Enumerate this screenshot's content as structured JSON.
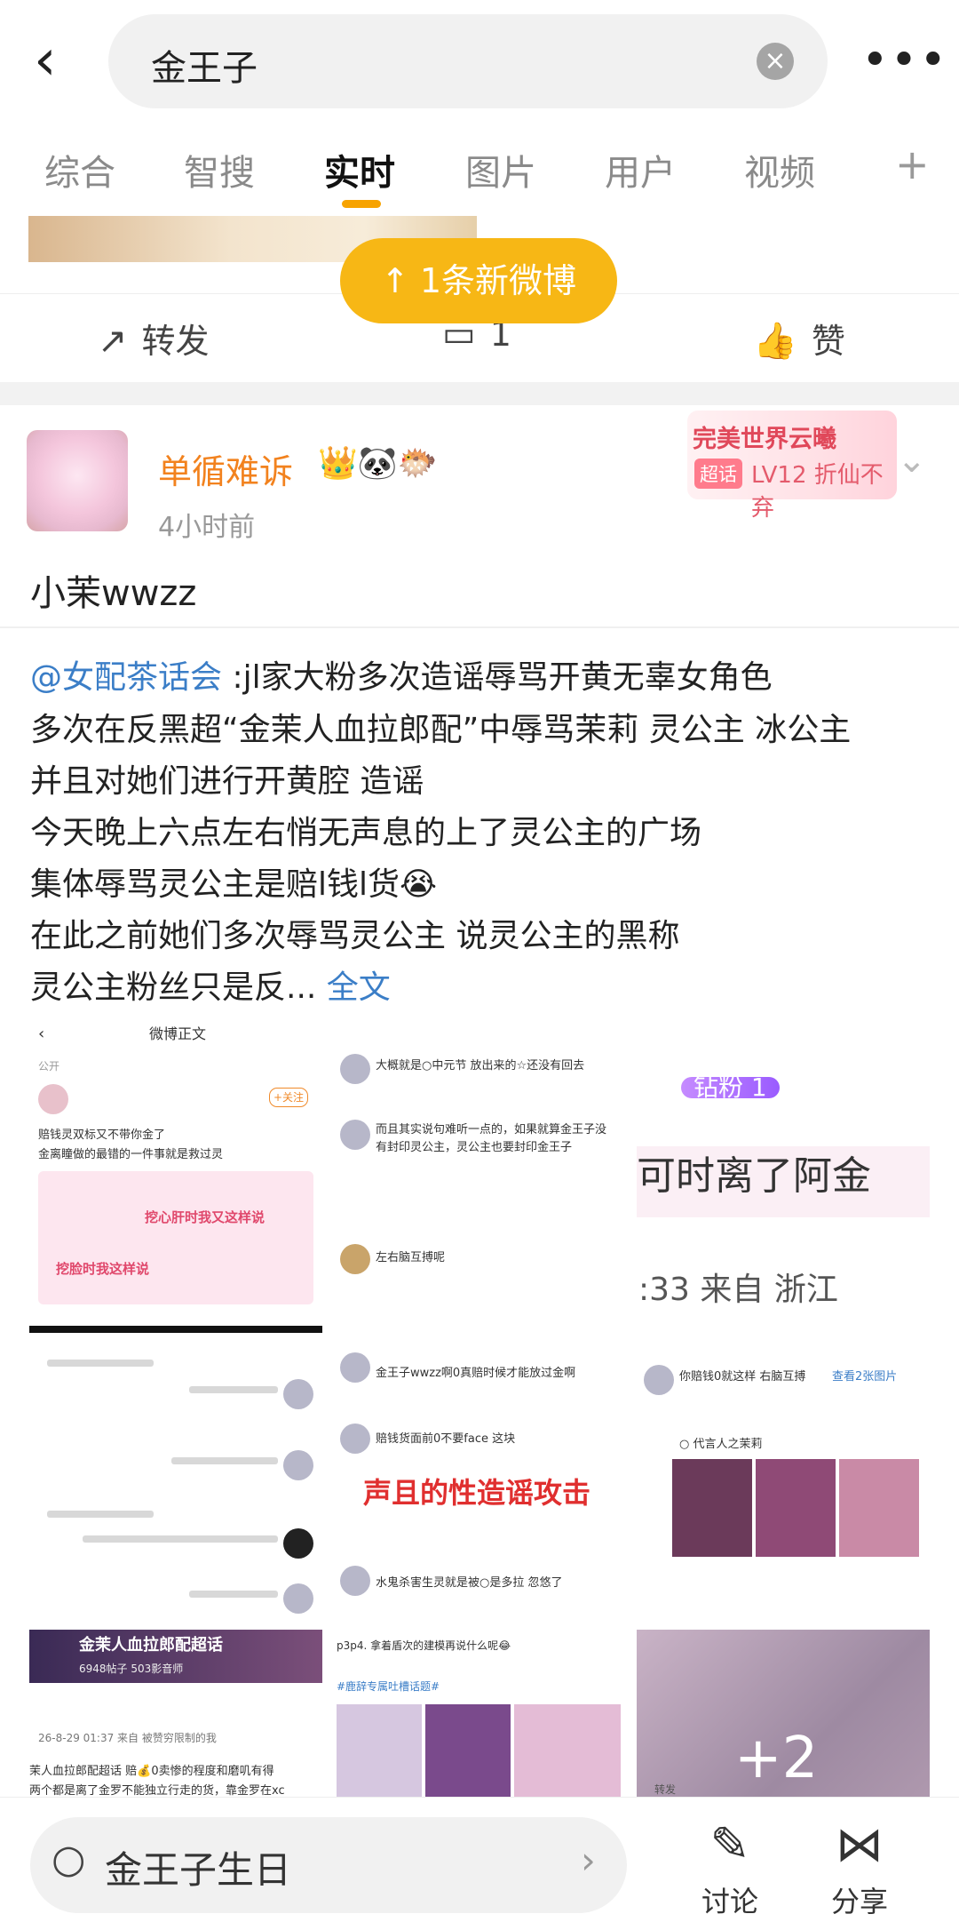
{
  "search": {
    "query": "金王子",
    "clear_icon": "×",
    "more_icon": "•••",
    "back_icon": "‹"
  },
  "tabs": [
    {
      "label": "综合"
    },
    {
      "label": "智搜"
    },
    {
      "label": "实时"
    },
    {
      "label": "图片"
    },
    {
      "label": "用户"
    },
    {
      "label": "视频"
    }
  ],
  "tabs_plus": "+",
  "new_posts_pill": "↑ 1条新微博",
  "prev_post_actions": {
    "repost": "转发",
    "comment_count": "1",
    "like": "赞"
  },
  "post": {
    "username": "单循难诉",
    "badges": "👑🐼🐡",
    "time": "4小时前",
    "chaohua_title": "完美世界云曦",
    "chaohua_tag": "超话",
    "chaohua_level": "LV12 折仙不弃",
    "title": "小茉wwzz",
    "mention": "@女配茶话会",
    "lines": [
      " :jl家大粉多次造谣辱骂开黄无辜女角色",
      "多次在反黑超“金茉人血拉郎配”中辱骂茉莉 灵公主 冰公主",
      "并且对她们进行开黄腔 造谣",
      "今天晚上六点左右悄无声息的上了灵公主的广场",
      "集体辱骂灵公主是赔l钱l货😭",
      "在此之前她们多次辱骂灵公主 说灵公主的黑称"
    ],
    "last_line": "灵公主粉丝只是反...",
    "full_text": "全文"
  },
  "grid": {
    "c1": {
      "header": "微博正文",
      "pub": "公开",
      "tag1": "挖心肝时我又这样说",
      "tag2": "挖脸时我这样说",
      "btn": "+关注",
      "l1": "赔钱灵双标又不带你金了",
      "l2": "金离瞳做的最错的一件事就是救过灵"
    },
    "c2": {
      "l1": "大概就是○中元节 放出来的☆还没有回去",
      "l2": "而且其实说句难听一点的，如果就算金王子没有封印灵公主，灵公主也要封印金王子",
      "l3": "左右脑互搏呢"
    },
    "c3": {
      "badge": "钻粉 1",
      "big": "可时离了阿金",
      "foot": ":33 来自 浙江"
    },
    "c5": {
      "l1": "金王子wwzz啊0真赔时候才能放过金啊",
      "l2": "赔钱货面前0不要face 这块",
      "red": "声且的性造谣攻击",
      "l3": "水鬼杀害生灵就是被○是多拉 忽悠了"
    },
    "c6": {
      "l1": "你赔钱0就这样 右脑互搏",
      "l2": "查看2张图片",
      "l3": "○ 代言人之茉莉"
    },
    "c7": {
      "title": "金茉人血拉郎配超话",
      "sub": "6948帖子 503影音师",
      "time": "26-8-29 01:37 来自 被赞穷限制的我",
      "l1": "茉人血拉郎配超话 赔💰0卖惨的程度和磨叽有得",
      "l2": "两个都是离了金罗不能独立行走的货，靠金罗在xc"
    },
    "c8": {
      "l1": "p3p4. 拿着盾次的建模再说什么呢😂",
      "l2": "#鹿辞专属吐槽话题#"
    },
    "c9": {
      "more": "+2",
      "foot": "转发"
    }
  },
  "bottom": {
    "search_text": "金王子生日",
    "discuss": "讨论",
    "share": "分享"
  },
  "icons": {
    "back": "back-arrow-icon",
    "clear": "clear-icon",
    "more": "more-icon",
    "repost": "repost-icon",
    "comment": "comment-icon",
    "like": "like-icon",
    "search": "search-icon",
    "discuss": "edit-icon",
    "share": "share-icon"
  },
  "colors": {
    "accent": "#f7b715",
    "username": "#f2821e",
    "link": "#3b7ec7"
  }
}
